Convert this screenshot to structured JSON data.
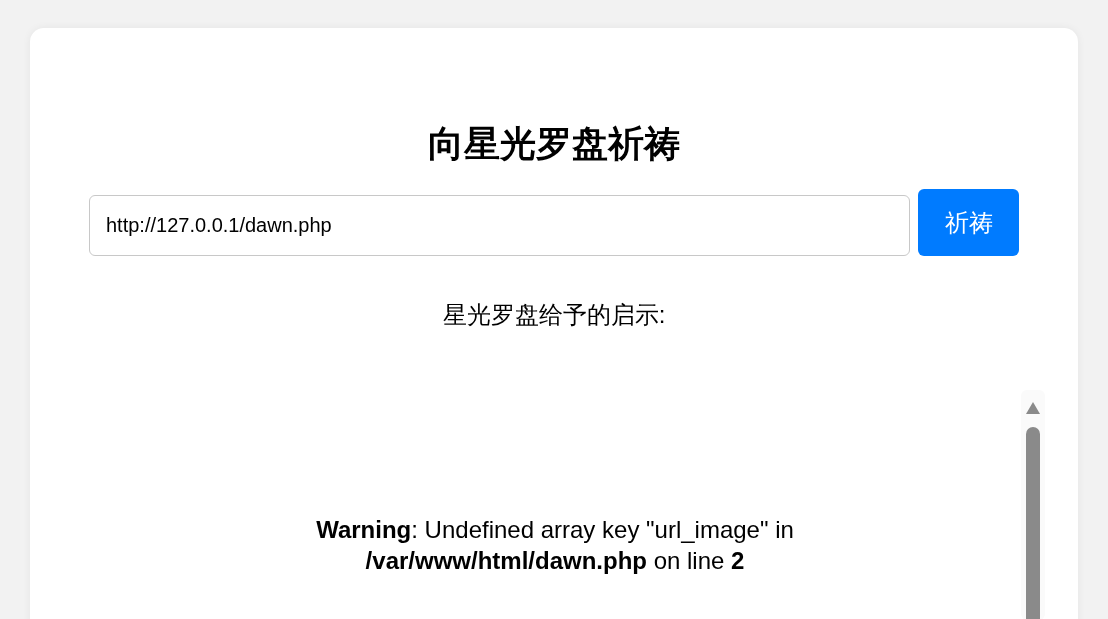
{
  "title": "向星光罗盘祈祷",
  "url_field": {
    "value": "http://127.0.0.1/dawn.php"
  },
  "submit_button": "祈祷",
  "result_label": "星光罗盘给予的启示:",
  "result_message": "**Warning**: Undefined array key \"url_image\" in **/var/www/html/dawn.php** on line **2**"
}
